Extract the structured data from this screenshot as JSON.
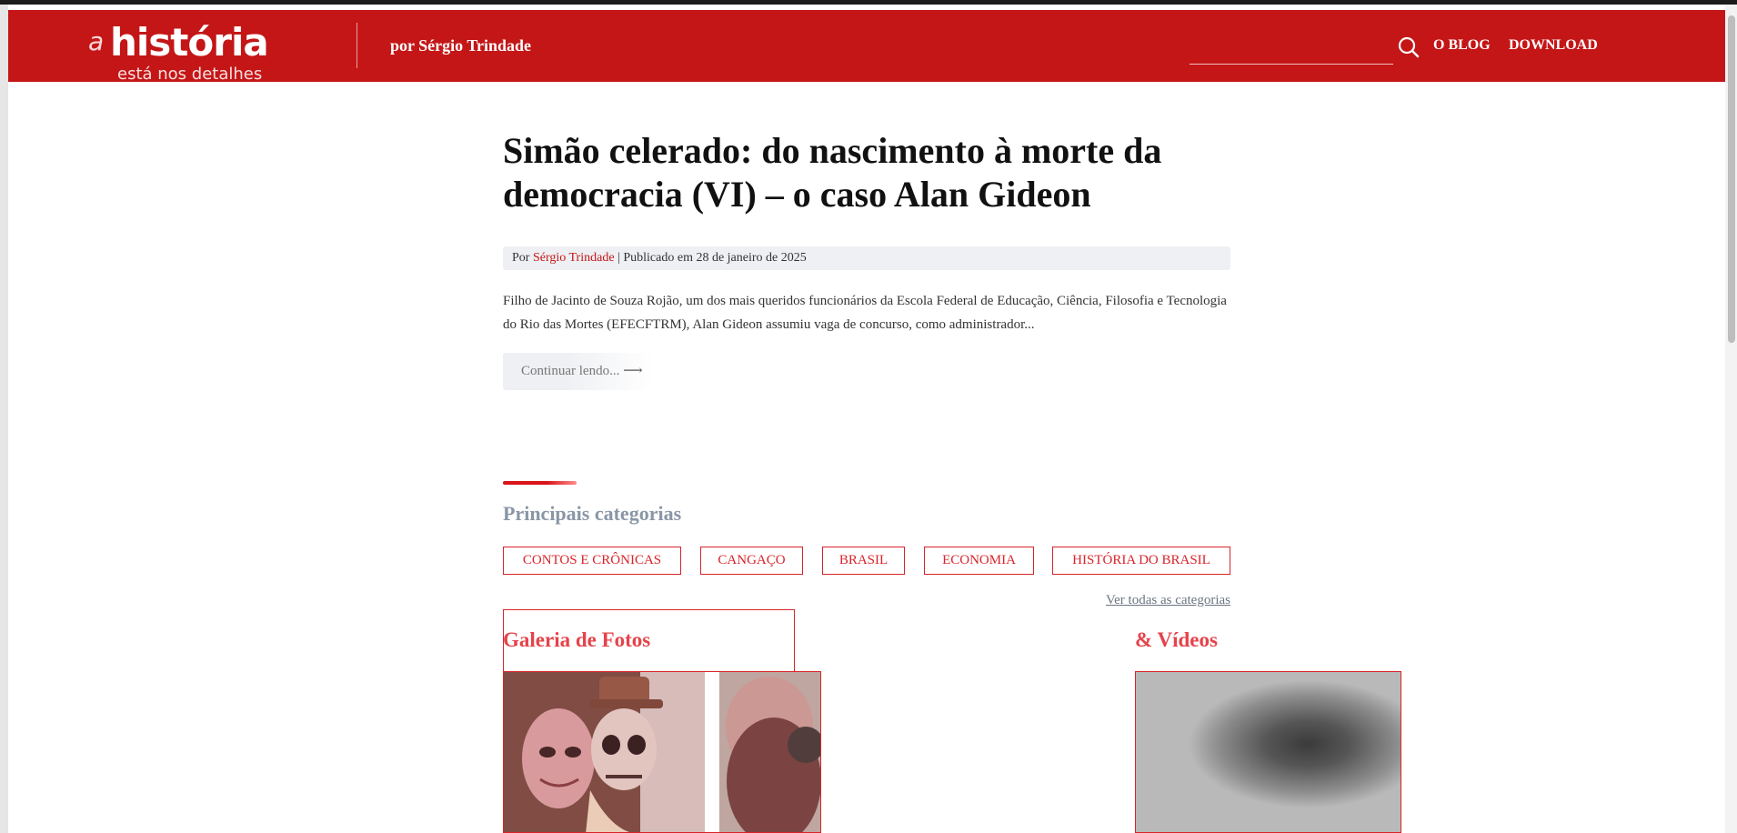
{
  "header": {
    "logo": {
      "a": "a",
      "word": "história",
      "tagline": "está nos detalhes"
    },
    "byline": "por Sérgio Trindade",
    "search": {
      "value": "",
      "placeholder": ""
    },
    "nav": [
      {
        "label": "O BLOG"
      },
      {
        "label": "DOWNLOAD"
      }
    ]
  },
  "post": {
    "title": "Simão celerado: do nascimento à morte da democracia (VI) – o caso Alan Gideon",
    "meta": {
      "prefix": "Por ",
      "author": "Sérgio Trindade",
      "separator": " | ",
      "published": "Publicado em 28 de janeiro de 2025"
    },
    "excerpt": "Filho de Jacinto de Souza Rojão, um dos mais queridos funcionários da Escola Federal de Educação, Ciência, Filosofia e Tecnologia do Rio das Mortes (EFECFTRM), Alan Gideon assumiu vaga de concurso, como administrador...",
    "read_more": "Continuar lendo...",
    "read_more_arrow": "⟶"
  },
  "categories": {
    "heading": "Principais categorias",
    "items": [
      {
        "label": "CONTOS E CRÔNICAS"
      },
      {
        "label": "CANGAÇO"
      },
      {
        "label": "BRASIL"
      },
      {
        "label": "ECONOMIA"
      },
      {
        "label": "HISTÓRIA DO BRASIL"
      }
    ],
    "all_link": "Ver todas as categorias"
  },
  "gallery": {
    "title": "Galeria de Fotos"
  },
  "videos": {
    "title": "& Vídeos"
  },
  "colors": {
    "brand_red": "#c41617",
    "accent_red": "#d8242a",
    "heading_gray": "#8a96a6",
    "meta_bg": "#eef0f3"
  }
}
